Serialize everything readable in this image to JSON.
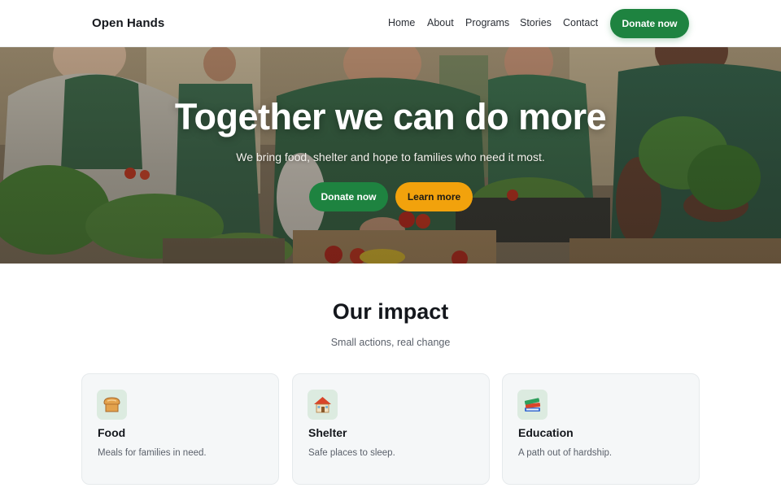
{
  "brand": {
    "name": "Open Hands"
  },
  "nav": {
    "items": [
      {
        "label": "Home"
      },
      {
        "label": "About"
      },
      {
        "label": "Programs"
      },
      {
        "label": "Stories"
      },
      {
        "label": "Contact"
      }
    ],
    "cta_label": "Donate now"
  },
  "hero": {
    "title": "Together we can do more",
    "subtitle": "We bring food, shelter and hope to families who need it most.",
    "primary_cta": "Donate now",
    "secondary_cta": "Learn more",
    "image": "volunteers-sorting-produce-photo"
  },
  "impact": {
    "title": "Our impact",
    "subtitle": "Small actions, real change",
    "cards": [
      {
        "icon": "bread-icon",
        "title": "Food",
        "description": "Meals for families in need."
      },
      {
        "icon": "house-icon",
        "title": "Shelter",
        "description": "Safe places to sleep."
      },
      {
        "icon": "books-icon",
        "title": "Education",
        "description": "A path out of hardship."
      }
    ]
  },
  "colors": {
    "primary": "#1e8340",
    "accent": "#f2a20c",
    "card_bg": "#f5f7f8",
    "text": "#14171c",
    "muted": "#5b616b"
  }
}
